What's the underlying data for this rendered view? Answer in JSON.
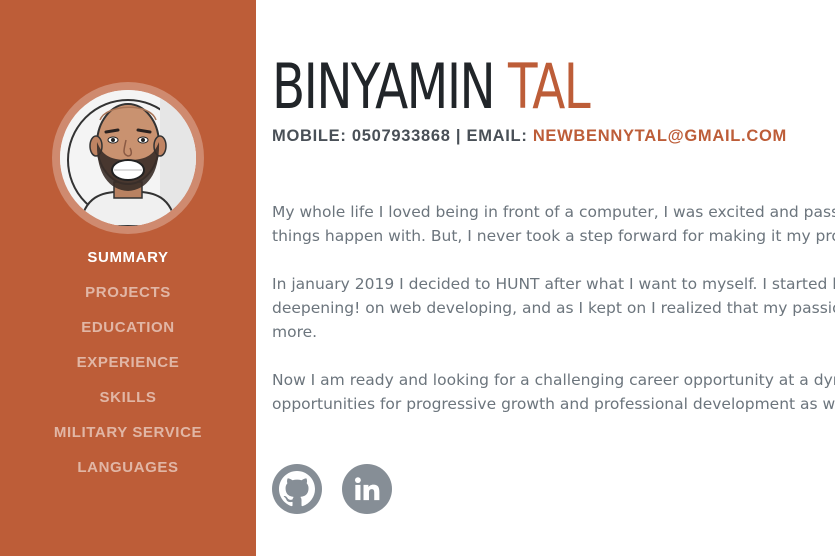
{
  "profile": {
    "first_name": "BINYAMIN",
    "last_name": "TAL",
    "contact_prefix": "MOBILE: 0507933868 | EMAIL: ",
    "email": "NEWBENNYTAL@GMAIL.COM"
  },
  "nav": {
    "items": [
      {
        "label": "SUMMARY",
        "active": true
      },
      {
        "label": "PROJECTS",
        "active": false
      },
      {
        "label": "EDUCATION",
        "active": false
      },
      {
        "label": "EXPERIENCE",
        "active": false
      },
      {
        "label": "SKILLS",
        "active": false
      },
      {
        "label": "MILITARY SERVICE",
        "active": false
      },
      {
        "label": "LANGUAGES",
        "active": false
      }
    ]
  },
  "summary": {
    "p1_line1": "My whole life I loved being in front of a computer, I was excited and passion",
    "p1_line2": "things happen with. But, I never took a step forward for making it my profe",
    "p2_line1": "In january 2019 I decided to HUNT after what I want to myself. I started lear",
    "p2_line2": "deepening! on web developing, and as I kept on I realized that my passion",
    "p2_line3": "more.",
    "p3_line1": "Now I am ready and looking for a challenging career opportunity at a dynar",
    "p3_line2": "opportunities for progressive growth and professional development as web"
  },
  "social": {
    "icons": [
      "github-icon",
      "linkedin-icon"
    ]
  },
  "colors": {
    "accent": "#bd5d38",
    "text_dark": "#212529",
    "text_muted": "#6c757d",
    "icon_gray": "#868e96"
  }
}
